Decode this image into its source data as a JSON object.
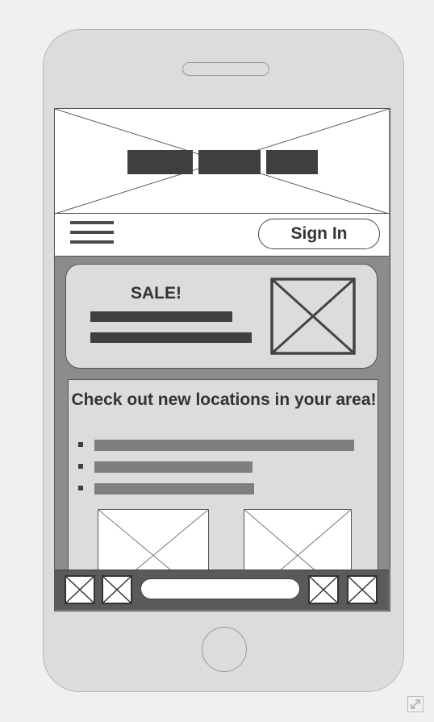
{
  "navbar": {
    "signin_label": "Sign In"
  },
  "sale": {
    "title": "SALE!"
  },
  "locations": {
    "title": "Check out new locations in your area!"
  },
  "search": {
    "placeholder": ""
  },
  "colors": {
    "dark": "#3f3f3f",
    "screen_bg": "#8c8c8c",
    "card_bg": "#dcdcdc",
    "bar": "#7e7e7e"
  },
  "icons": [
    "hamburger-icon",
    "image-placeholder-icon",
    "expand-icon"
  ]
}
